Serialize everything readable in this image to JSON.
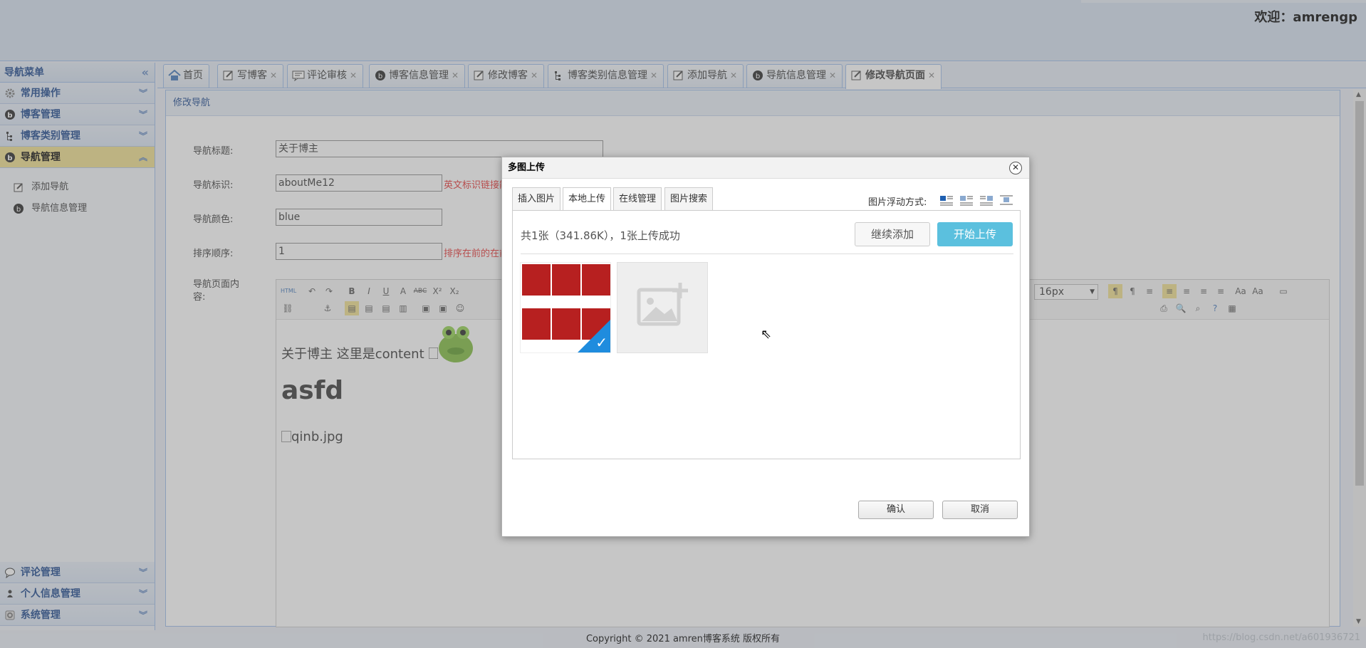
{
  "header": {
    "welcome": "欢迎：amrengp"
  },
  "sidebar": {
    "title": "导航菜单",
    "collapse_icon": "«",
    "sections_top": [
      {
        "label": "常用操作",
        "icon": "gear-icon"
      },
      {
        "label": "博客管理",
        "icon": "blog-icon"
      },
      {
        "label": "博客类别管理",
        "icon": "tree-icon"
      },
      {
        "label": "导航管理",
        "icon": "blog-icon"
      }
    ],
    "sub_items": [
      {
        "label": "添加导航",
        "icon": "edit-icon"
      },
      {
        "label": "导航信息管理",
        "icon": "blog-icon"
      }
    ],
    "sections_bottom": [
      {
        "label": "评论管理",
        "icon": "comment-icon"
      },
      {
        "label": "个人信息管理",
        "icon": "person-icon"
      },
      {
        "label": "系统管理",
        "icon": "settings-icon"
      }
    ]
  },
  "tabs": [
    {
      "label": "首页",
      "icon": "home-icon",
      "closable": false
    },
    {
      "label": "写博客",
      "icon": "edit-icon",
      "closable": true
    },
    {
      "label": "评论审核",
      "icon": "comment-icon",
      "closable": true
    },
    {
      "label": "博客信息管理",
      "icon": "blog-icon",
      "closable": true
    },
    {
      "label": "修改博客",
      "icon": "edit-icon",
      "closable": true
    },
    {
      "label": "博客类别信息管理",
      "icon": "tree-icon",
      "closable": true
    },
    {
      "label": "添加导航",
      "icon": "edit-icon",
      "closable": true
    },
    {
      "label": "导航信息管理",
      "icon": "blog-icon",
      "closable": true
    },
    {
      "label": "修改导航页面",
      "icon": "edit-icon",
      "closable": true,
      "active": true
    }
  ],
  "panel": {
    "title": "修改导航"
  },
  "form": {
    "title_label": "导航标题:",
    "title_value": "关于博主",
    "key_label": "导航标识:",
    "key_value": "aboutMe12",
    "key_hint": "英文标识链接能",
    "color_label": "导航颜色:",
    "color_value": "blue",
    "order_label": "排序顺序:",
    "order_value": "1",
    "order_hint": "排序在前的在前",
    "content_label": "导航页面内容:"
  },
  "editor": {
    "font_size": "16px",
    "line1": "关于博主 这里是content 🗌",
    "heading": "asfd",
    "broken_image": "qinb.jpg"
  },
  "dialog": {
    "title": "多图上传",
    "tabs": [
      "插入图片",
      "本地上传",
      "在线管理",
      "图片搜索"
    ],
    "active_tab": "本地上传",
    "float_label": "图片浮动方式:",
    "status": "共1张（341.86K），1张上传成功",
    "continue_button": "继续添加",
    "start_button": "开始上传",
    "confirm_button": "确认",
    "cancel_button": "取消"
  },
  "footer": {
    "copyright": "Copyright © 2021 amren博客系统 版权所有",
    "watermark": "https://blog.csdn.net/a601936721"
  },
  "colors": {
    "accent": "#5bc0de",
    "active_section": "#f0de8a",
    "hint": "#e53030"
  }
}
